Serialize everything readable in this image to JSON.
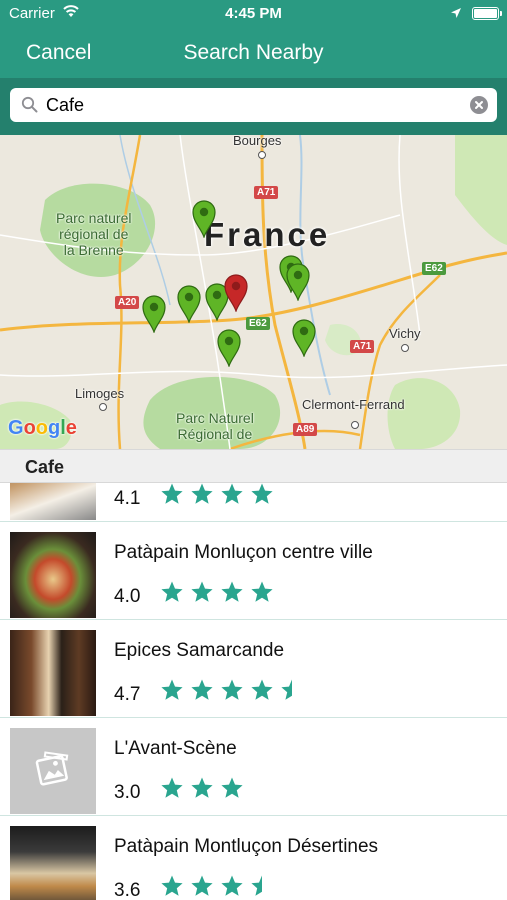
{
  "status_bar": {
    "carrier": "Carrier",
    "time": "4:45 PM"
  },
  "nav": {
    "cancel_label": "Cancel",
    "title": "Search Nearby"
  },
  "search": {
    "value": "Cafe"
  },
  "map": {
    "country_label": "France",
    "places": [
      "Bourges",
      "Vichy",
      "Limoges",
      "Clermont-Ferrand"
    ],
    "parks": [
      "Parc naturel\nrégional de\nla Brenne",
      "Parc Naturel\nRégional de"
    ],
    "roads": [
      "A71",
      "E62",
      "A20",
      "E62",
      "A71",
      "A89"
    ],
    "attribution": "Google",
    "accent_pin_color": "#c62828",
    "pin_color": "#5fb526"
  },
  "section": {
    "title": "Cafe"
  },
  "accent_color": "#2aa58f",
  "results": [
    {
      "name": "",
      "rating": "4.1",
      "stars": 4,
      "thumb": "food-photo"
    },
    {
      "name": "Patàpain Monluçon centre ville",
      "rating": "4.0",
      "stars": 4,
      "thumb": "food-photo"
    },
    {
      "name": "Epices Samarcande",
      "rating": "4.7",
      "stars": 4.5,
      "thumb": "shop-photo"
    },
    {
      "name": "L'Avant-Scène",
      "rating": "3.0",
      "stars": 3,
      "thumb": "placeholder-photo-icon"
    },
    {
      "name": "Patàpain Montluçon Désertines",
      "rating": "3.6",
      "stars": 3.5,
      "thumb": "bakery-photo"
    }
  ]
}
